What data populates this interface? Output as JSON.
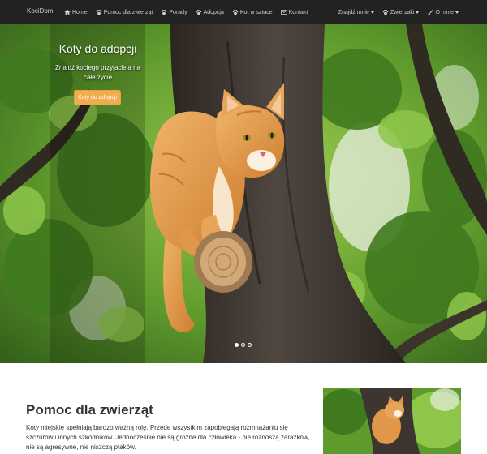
{
  "navbar": {
    "brand": "KociDom",
    "items": [
      {
        "label": "Home",
        "icon": "home-icon"
      },
      {
        "label": "Pomoc dla zwierząt",
        "icon": "paw-icon"
      },
      {
        "label": "Porady",
        "icon": "paw-icon"
      },
      {
        "label": "Adopcja",
        "icon": "paw-icon"
      },
      {
        "label": "Kot w sztuce",
        "icon": "paw-icon"
      },
      {
        "label": "Kontakt",
        "icon": "envelope-icon"
      }
    ],
    "right_items": [
      {
        "label": "Znajdź mnie"
      },
      {
        "label": "Zwierzaki",
        "icon": "paw-icon"
      },
      {
        "label": "O mnie",
        "icon": "brush-icon"
      }
    ]
  },
  "hero": {
    "title": "Koty do adopcji",
    "subtitle": "Znajdź kociego przyjaciela na całe życie",
    "button_label": "Koty do adopcji",
    "slides": 3,
    "active_slide": 1
  },
  "section": {
    "title": "Pomoc dla zwierząt",
    "text": "Koty miejskie spełniają bardzo ważną rolę. Przede wszystkim zapobiegają rozmnażaniu się szczurów i innych szkodników. Jednocześnie nie są groźne dla człowieka - nie roznoszą zarazków, nie są agresywne, nie niszczą ptaków."
  },
  "colors": {
    "navbar_bg": "#222222",
    "button_warning": "#f0ad4e",
    "text": "#333333"
  }
}
